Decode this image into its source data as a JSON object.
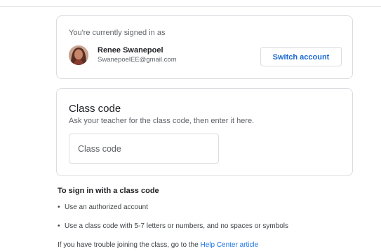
{
  "account": {
    "signed_in_label": "You're currently signed in as",
    "user_name": "Renee Swanepoel",
    "user_email": "SwanepoelEE@gmail.com",
    "switch_button": "Switch account"
  },
  "class_code": {
    "title": "Class code",
    "subtitle": "Ask your teacher for the class code, then enter it here.",
    "input_placeholder": "Class code",
    "input_value": ""
  },
  "info": {
    "heading": "To sign in with a class code",
    "items": [
      "Use an authorized account",
      "Use a class code with 5-7 letters or numbers, and no spaces or symbols"
    ],
    "bullet": "•",
    "help_prefix": "If you have trouble joining the class, go to the ",
    "help_link": "Help Center article"
  },
  "colors": {
    "accent": "#1a73e8",
    "button_text": "#1967d2",
    "border": "#dadce0"
  }
}
